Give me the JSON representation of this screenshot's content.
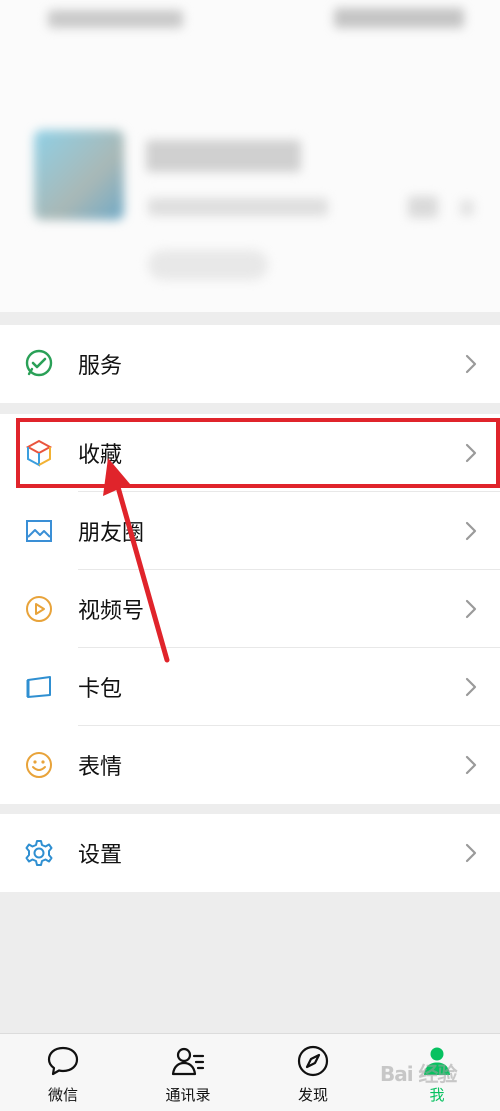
{
  "menu": {
    "services": {
      "label": "服务",
      "icon": "services-icon"
    },
    "favorites": {
      "label": "收藏",
      "icon": "favorites-cube-icon"
    },
    "moments": {
      "label": "朋友圈",
      "icon": "moments-picture-icon"
    },
    "channels": {
      "label": "视频号",
      "icon": "channels-play-icon"
    },
    "cards": {
      "label": "卡包",
      "icon": "card-wallet-icon"
    },
    "stickers": {
      "label": "表情",
      "icon": "smiley-icon"
    },
    "settings": {
      "label": "设置",
      "icon": "gear-icon"
    }
  },
  "tabbar": {
    "items": [
      {
        "label": "微信",
        "icon": "chat-bubble-icon"
      },
      {
        "label": "通讯录",
        "icon": "contacts-icon"
      },
      {
        "label": "发现",
        "icon": "compass-icon"
      },
      {
        "label": "我",
        "icon": "person-icon",
        "active": true
      }
    ]
  },
  "watermark": "Bai 经验",
  "colors": {
    "highlight": "#e0242b",
    "arrow": "#e0242b",
    "active_tab": "#07c160",
    "background": "#ededed"
  }
}
